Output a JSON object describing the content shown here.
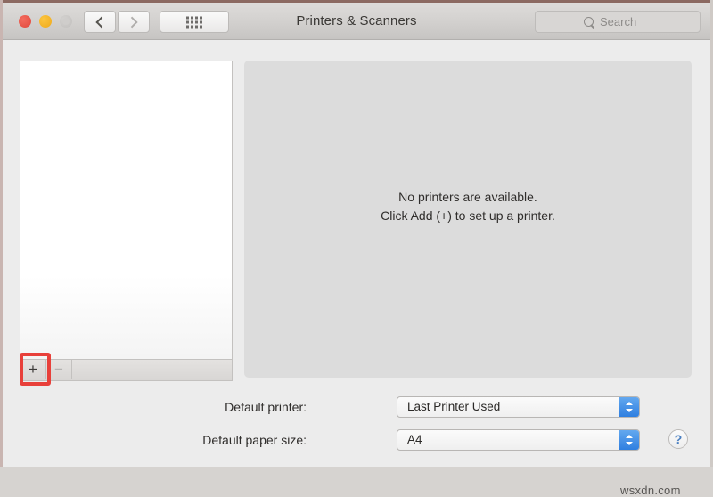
{
  "window": {
    "title": "Printers & Scanners",
    "traffic_lights": {
      "close": "close-button",
      "minimize": "minimize-button",
      "zoom": "zoom-button-disabled"
    }
  },
  "toolbar": {
    "back_label": "‹",
    "forward_label": "›",
    "grid_label": "show-all-grid",
    "search": {
      "placeholder": "Search",
      "value": "",
      "icon": "search-icon"
    }
  },
  "printer_list": {
    "items": [],
    "add_label": "+",
    "remove_label": "−",
    "add_highlighted": true
  },
  "detail_pane": {
    "empty_line_1": "No printers are available.",
    "empty_line_2": "Click Add (+) to set up a printer."
  },
  "settings": {
    "default_printer": {
      "label": "Default printer:",
      "value": "Last Printer Used"
    },
    "default_paper_size": {
      "label": "Default paper size:",
      "value": "A4"
    }
  },
  "help": {
    "label": "?"
  },
  "watermark": {
    "text": "wsxdn.com"
  },
  "colors": {
    "accent_blue": "#3f8ce4",
    "highlight_red": "#e8403a",
    "window_bg": "#ececec",
    "pane_bg": "#dcdcdc"
  }
}
